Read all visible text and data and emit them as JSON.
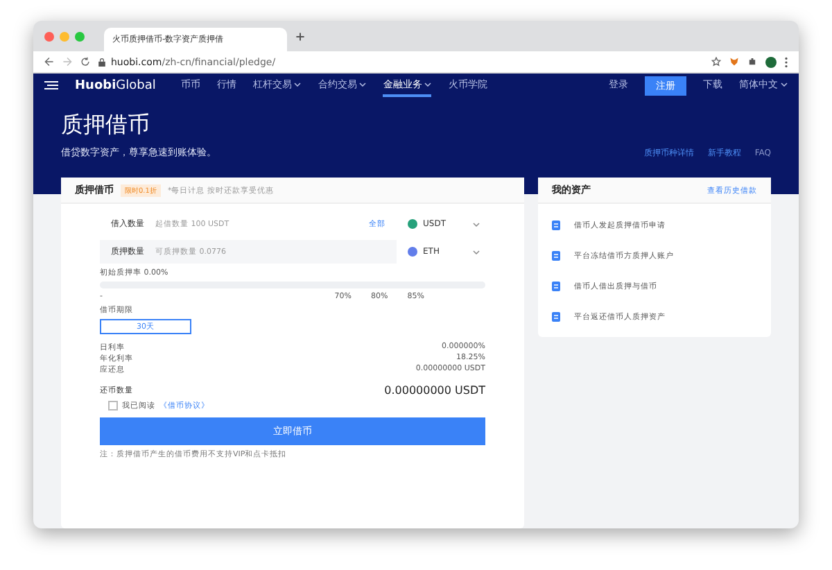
{
  "browser": {
    "tab_title": "火币质押借币-数字资产质押借",
    "url_domain": "huobi.com",
    "url_path": "/zh-cn/financial/pledge/"
  },
  "nav": {
    "logo_main": "Huobi",
    "logo_sub": "Global",
    "items": [
      {
        "label": "币币",
        "dropdown": false,
        "selected": false
      },
      {
        "label": "行情",
        "dropdown": false,
        "selected": false
      },
      {
        "label": "杠杆交易",
        "dropdown": true,
        "selected": false
      },
      {
        "label": "合约交易",
        "dropdown": true,
        "selected": false
      },
      {
        "label": "金融业务",
        "dropdown": true,
        "selected": true
      },
      {
        "label": "火币学院",
        "dropdown": false,
        "selected": false
      }
    ],
    "login": "登录",
    "register": "注册",
    "download": "下载",
    "language": "简体中文"
  },
  "hero": {
    "title": "质押借币",
    "subtitle": "借贷数字资产，尊享急速到账体验。",
    "links": [
      "质押币种详情",
      "新手教程",
      "FAQ"
    ]
  },
  "form": {
    "title": "质押借币",
    "badge": "限时0.1折",
    "note": "*每日计息 按时还款享受优惠",
    "fields": [
      {
        "label": "借入数量",
        "placeholder": "起借数量 100 USDT",
        "action": "全部",
        "coin": "USDT",
        "color": "#26a17b"
      },
      {
        "label": "质押数量",
        "placeholder": "可质押数量 0.0776",
        "coin": "ETH",
        "color": "#627eea"
      }
    ],
    "rate_label": "初始质押率 0.00%",
    "slider": {
      "level": 0,
      "start": "-",
      "ticks": [
        "70%",
        "80%",
        "85%"
      ]
    },
    "term_label": "借币期限",
    "terms": [
      {
        "label": "30天",
        "selected": true
      }
    ],
    "stats": [
      {
        "label": "日利率",
        "value": "0.000000%"
      },
      {
        "label": "年化利率",
        "value": "18.25%"
      },
      {
        "label": "应还息",
        "value": "0.00000000 USDT"
      }
    ],
    "repay_label": "还币数量",
    "repay_value": "0.00000000 USDT",
    "agreement": {
      "checked": false,
      "text": "我已阅读",
      "link": "《借币协议》"
    },
    "submit": "立即借币",
    "footnote": "注：质押借币产生的借币费用不支持VIP和点卡抵扣"
  },
  "assets": {
    "title": "我的资产",
    "link": "查看历史借款",
    "steps": [
      "借币人发起质押借币申请",
      "平台冻结借币方质押人账户",
      "借币人借出质押与借币",
      "平台返还借币人质押资产"
    ]
  }
}
